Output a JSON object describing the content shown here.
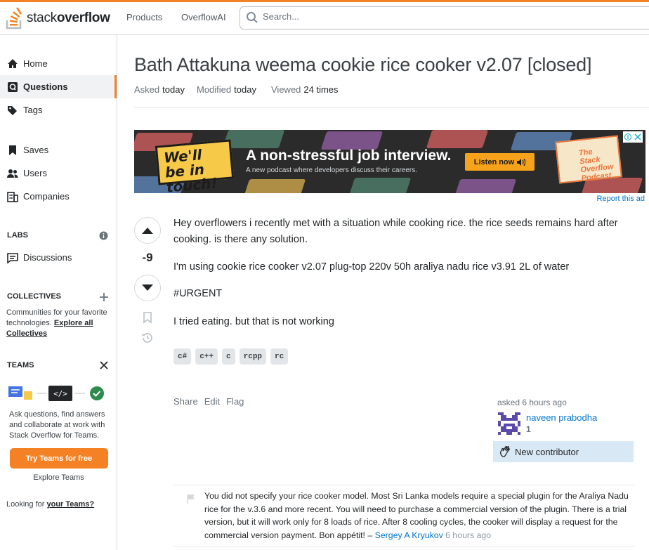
{
  "header": {
    "logo_light": "stack",
    "logo_bold": "overflow",
    "nav": [
      "Products",
      "OverflowAI"
    ],
    "search_placeholder": "Search..."
  },
  "sidebar": {
    "items": [
      {
        "label": "Home",
        "icon": "home-icon",
        "active": false
      },
      {
        "label": "Questions",
        "icon": "questions-icon",
        "active": true
      },
      {
        "label": "Tags",
        "icon": "tag-icon",
        "active": false
      },
      {
        "label": "Saves",
        "icon": "bookmark-icon",
        "active": false
      },
      {
        "label": "Users",
        "icon": "users-icon",
        "active": false
      },
      {
        "label": "Companies",
        "icon": "companies-icon",
        "active": false
      }
    ],
    "labs": {
      "heading": "LABS",
      "discussions": "Discussions"
    },
    "collectives": {
      "heading": "COLLECTIVES",
      "text": "Communities for your favorite technologies.",
      "link": "Explore all Collectives"
    },
    "teams": {
      "heading": "TEAMS",
      "text": "Ask questions, find answers and collaborate at work with Stack Overflow for Teams.",
      "button": "Try Teams for free",
      "explore": "Explore Teams",
      "looking": "Looking for",
      "looking_link": "your Teams?"
    }
  },
  "question": {
    "title": "Bath Attakuna weema cookie rice cooker v2.07 [closed]",
    "asked_label": "Asked",
    "asked_value": "today",
    "modified_label": "Modified",
    "modified_value": "today",
    "viewed_label": "Viewed",
    "viewed_value": "24 times",
    "score": "-9",
    "body": [
      "Hey overflowers i recently met with a situation while cooking rice. the rice seeds remains hard after cooking. is there any solution.",
      "I'm using cookie rice cooker v2.07 plug-top 220v 50h araliya nadu rice v3.91 2L of water",
      "#URGENT",
      "I tried eating. but that is not working"
    ],
    "tags": [
      "c#",
      "c++",
      "c",
      "rcpp",
      "rc"
    ],
    "actions": [
      "Share",
      "Edit",
      "Flag"
    ],
    "owner": {
      "asked": "asked 6 hours ago",
      "name": "naveen prabodha",
      "rep": "1",
      "badge": "New contributor"
    }
  },
  "ad": {
    "badge": "We'll be in touch!",
    "headline": "A non-stressful job interview.",
    "sub": "A new podcast where developers discuss their careers.",
    "button": "Listen now",
    "podcast": "The Stack Overflow Podcast",
    "report": "Report this ad"
  },
  "comment": {
    "text": "You did not specify your rice cooker model. Most Sri Lanka models require a special plugin for the Araliya Nadu rice for the v.3.6 and more recent. You will need to purchase a commercial version of the plugin. There is a trial version, but it will work only for 8 loads of rice. After 8 cooling cycles, the cooker will display a request for the commercial version payment. Bon appétit! –",
    "user": "Sergey A Kryukov",
    "time": "6 hours ago"
  },
  "colors": {
    "accent": "#f48225",
    "link": "#0074cc",
    "new_contributor_bg": "#d8e8f5"
  }
}
